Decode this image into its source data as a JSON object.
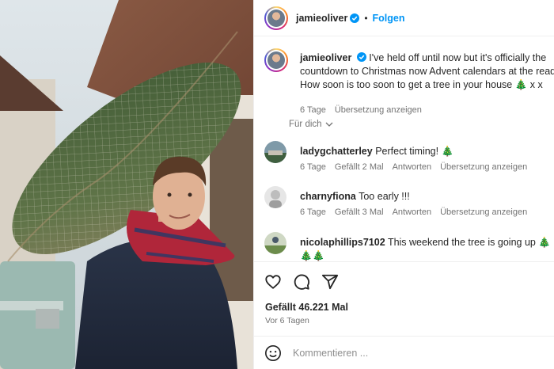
{
  "post": {
    "author": "jamieoliver",
    "follow_label": "Folgen",
    "caption_lines": [
      "I've held off until now but it's officially the",
      "countdown to Christmas now Advent calendars at the ready",
      "How soon is too soon to get a tree in your house 🎄 x x"
    ],
    "caption_age": "6 Tage",
    "translate_label": "Übersetzung anzeigen",
    "sort_label": "Für dich"
  },
  "comments": [
    {
      "user": "ladygchatterley",
      "text": "Perfect timing! 🎄",
      "age": "6 Tage",
      "likes": "Gefällt 2 Mal",
      "reply_label": "Antworten",
      "translate_label": "Übersetzung anzeigen"
    },
    {
      "user": "charnyfiona",
      "text": "Too early !!!",
      "age": "6 Tage",
      "likes": "Gefällt 3 Mal",
      "reply_label": "Antworten",
      "translate_label": "Übersetzung anzeigen"
    },
    {
      "user": "nicolaphillips7102",
      "text": "This weekend the tree is going up 🎄🎄🎄",
      "text_line2": "🎅"
    }
  ],
  "stats": {
    "likes": "Gefällt 46.221 Mal",
    "age": "Vor 6 Tagen"
  },
  "composer": {
    "placeholder": "Kommentieren ..."
  },
  "icons": [
    "heart-icon",
    "comment-icon",
    "share-icon",
    "emoji-icon",
    "verified-icon",
    "chevron-down-icon"
  ],
  "colors": {
    "follow": "#0095f6",
    "verified": "#0095f6",
    "muted": "#737373"
  }
}
